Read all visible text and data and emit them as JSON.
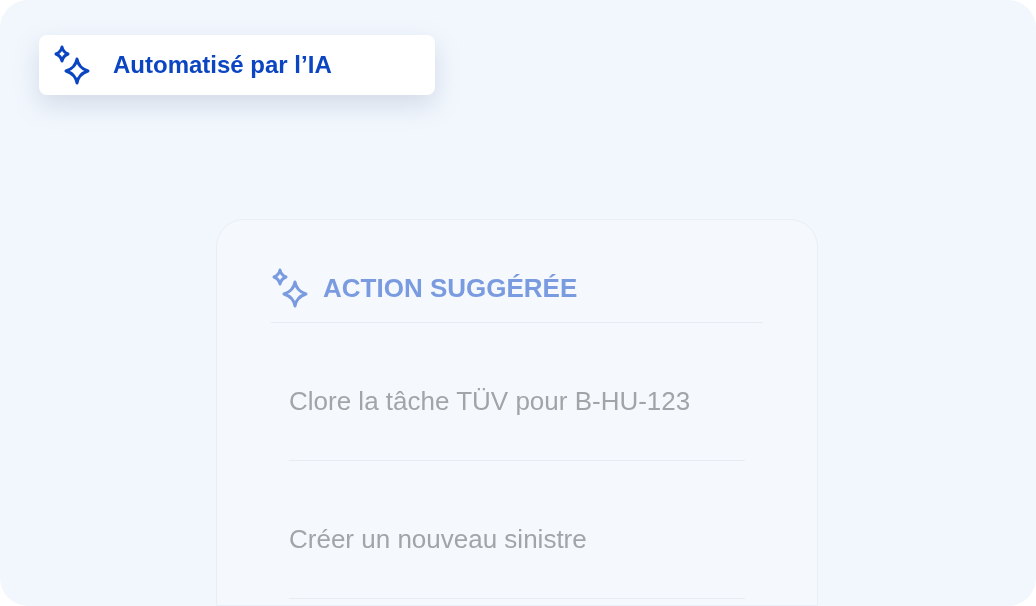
{
  "badge": {
    "label": "Automatisé par l’IA"
  },
  "card": {
    "heading": "ACTION SUGGÉRÉE",
    "actions": [
      "Clore la tâche TÜV pour B-HU-123",
      "Créer un nouveau sinistre"
    ]
  }
}
